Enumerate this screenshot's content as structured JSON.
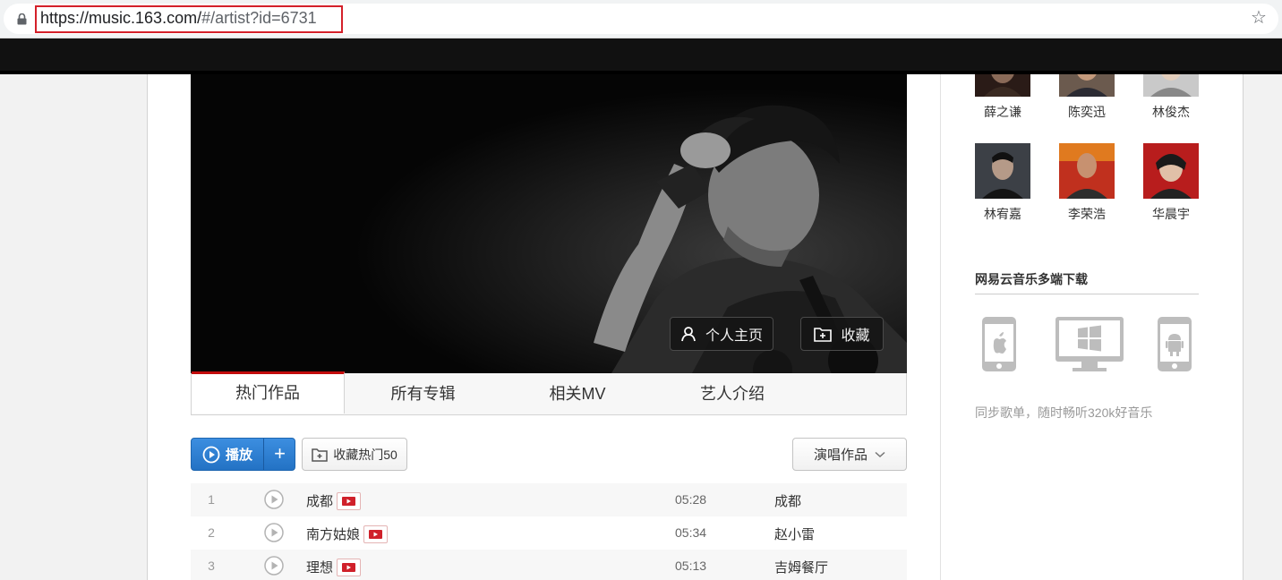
{
  "browser": {
    "url_host": "https://music.163.com/",
    "url_rest": "#/artist?id=6731"
  },
  "banner": {
    "homepage_label": "个人主页",
    "collect_label": "收藏"
  },
  "tabs": [
    {
      "label": "热门作品",
      "active": true
    },
    {
      "label": "所有专辑",
      "active": false
    },
    {
      "label": "相关MV",
      "active": false
    },
    {
      "label": "艺人介绍",
      "active": false
    }
  ],
  "toolbar": {
    "play_label": "播放",
    "plus_label": "+",
    "collect_hot_label": "收藏热门50",
    "filter_label": "演唱作品"
  },
  "songs": [
    {
      "index": "1",
      "title": "成都",
      "duration": "05:28",
      "album": "成都"
    },
    {
      "index": "2",
      "title": "南方姑娘",
      "duration": "05:34",
      "album": "赵小雷"
    },
    {
      "index": "3",
      "title": "理想",
      "duration": "05:13",
      "album": "吉姆餐厅"
    }
  ],
  "similar_artists": [
    {
      "name": "薛之谦"
    },
    {
      "name": "陈奕迅"
    },
    {
      "name": "林俊杰"
    },
    {
      "name": "林宥嘉"
    },
    {
      "name": "李荣浩"
    },
    {
      "name": "华晨宇"
    }
  ],
  "download": {
    "title": "网易云音乐多端下载",
    "note": "同步歌单，随时畅听320k好音乐",
    "platforms": [
      "apple-icon",
      "windows-icon",
      "android-icon"
    ]
  },
  "colors": {
    "brand_red": "#c20c0c",
    "play_blue": "#2b7fd4",
    "url_highlight": "#d4202a"
  }
}
